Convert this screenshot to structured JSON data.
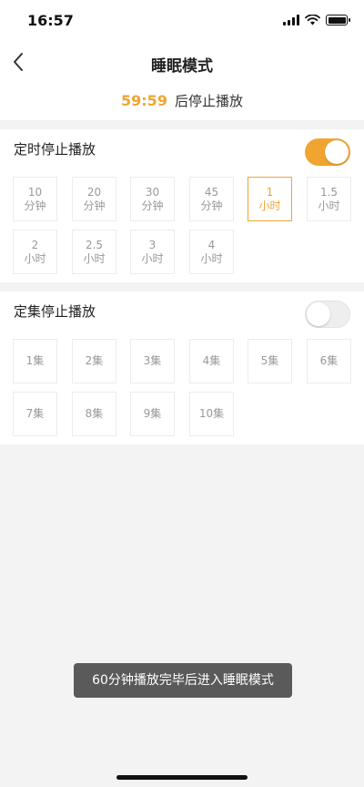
{
  "status_bar": {
    "time": "16:57"
  },
  "nav": {
    "title": "睡眠模式",
    "back_icon": "chevron-left-icon"
  },
  "countdown": {
    "time": "59:59",
    "suffix": "后停止播放"
  },
  "timer_section": {
    "title": "定时停止播放",
    "toggle_on": true,
    "options": [
      {
        "value": "10",
        "unit": "分钟"
      },
      {
        "value": "20",
        "unit": "分钟"
      },
      {
        "value": "30",
        "unit": "分钟"
      },
      {
        "value": "45",
        "unit": "分钟"
      },
      {
        "value": "1",
        "unit": "小时"
      },
      {
        "value": "1.5",
        "unit": "小时"
      },
      {
        "value": "2",
        "unit": "小时"
      },
      {
        "value": "2.5",
        "unit": "小时"
      },
      {
        "value": "3",
        "unit": "小时"
      },
      {
        "value": "4",
        "unit": "小时"
      }
    ],
    "selected_index": 4
  },
  "episode_section": {
    "title": "定集停止播放",
    "toggle_on": false,
    "options": [
      "1集",
      "2集",
      "3集",
      "4集",
      "5集",
      "6集",
      "7集",
      "8集",
      "9集",
      "10集"
    ]
  },
  "toast": {
    "message": "60分钟播放完毕后进入睡眠模式"
  },
  "colors": {
    "accent": "#f0a531",
    "toast_bg": "#5a5a5a",
    "page_bg": "#f3f3f3"
  }
}
